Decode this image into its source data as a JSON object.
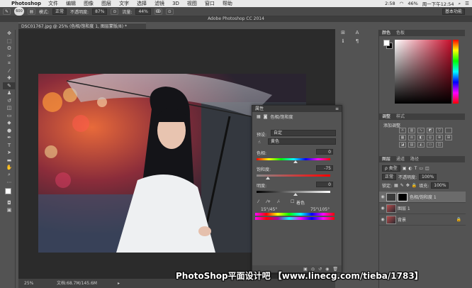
{
  "menubar": {
    "app": "Photoshop",
    "items": [
      "文件",
      "编辑",
      "图像",
      "图层",
      "文字",
      "选择",
      "滤镜",
      "3D",
      "视图",
      "窗口",
      "帮助"
    ],
    "status": {
      "battery": "46%",
      "clock": "周一下午12:54",
      "time2": "2:58"
    }
  },
  "options": {
    "mode_label": "模式:",
    "mode_value": "正常",
    "opacity_label": "不透明度:",
    "opacity_value": "87%",
    "flow_label": "流量:",
    "flow_value": "44%",
    "brush_size": "600",
    "workspace": "基本功能"
  },
  "window_title": "Adobe Photoshop CC 2014",
  "document": {
    "tab": "DSC01767.jpg @ 25% (色相/饱和度 1, 图层蒙版/8) *",
    "zoom": "25%",
    "doc_size": "文档:68.7M/145.6M"
  },
  "right": {
    "color_tabs": [
      "颜色",
      "色板"
    ],
    "adjust_tabs": [
      "调整",
      "样式"
    ],
    "adjust_label": "添加调整",
    "layers_tabs": [
      "图层",
      "通道",
      "路径"
    ],
    "kind": "ρ 类型",
    "blend": "正常",
    "opacity_label": "不透明度:",
    "opacity_value": "100%",
    "lock_label": "锁定:",
    "fill_label": "填充:",
    "fill_value": "100%",
    "layers": [
      {
        "name": "色相/饱和度 1",
        "active": true
      },
      {
        "name": "图层 1",
        "active": false
      },
      {
        "name": "背景",
        "active": false
      }
    ]
  },
  "properties": {
    "title": "属性",
    "sub": "色相/饱和度",
    "preset_label": "预设:",
    "preset_value": "自定",
    "channel_value": "黄色",
    "hue_label": "色相:",
    "hue_value": "0",
    "sat_label": "饱和度:",
    "sat_value": "-75",
    "light_label": "明度:",
    "light_value": "0",
    "colorize_label": "着色",
    "range_left": "15°/45°",
    "range_right": "75°\\105°"
  },
  "watermark": "PhotoShop平面设计吧 【www.linecg.com/tieba/1783】"
}
